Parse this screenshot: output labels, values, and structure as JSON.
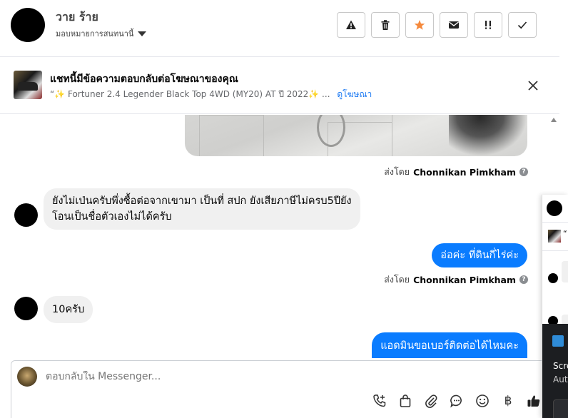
{
  "header": {
    "contact_name": "วาย ร้าย",
    "assign_label": "มอบหมายการสนทนานี้",
    "actions": [
      {
        "name": "report-button",
        "icon": "warning-icon"
      },
      {
        "name": "delete-button",
        "icon": "trash-icon"
      },
      {
        "name": "star-button",
        "icon": "star-icon"
      },
      {
        "name": "mark-unread-button",
        "icon": "envelope-icon"
      },
      {
        "name": "follow-up-button",
        "icon": "follow-up-icon"
      },
      {
        "name": "done-button",
        "icon": "check-icon"
      }
    ],
    "accent_star": "#f5893c"
  },
  "ad": {
    "title": "แชทนี้มีข้อความตอบกลับต่อโฆษณาของคุณ",
    "subtitle": "“✨ Fortuner 2.4 Legender Black Top 4WD (MY20) AT ปี 2022✨ ...",
    "view_ad_link": "ดูโฆษณา"
  },
  "messages": {
    "sent_by_prefix": "ส่งโดย",
    "sender_name": "Chonnikan Pimkham",
    "help_glyph": "?",
    "in_1": "ยังไม่เป่นครับพึ่งซื้อต่อจากเขามา เป็นที่ สปก ยังเสียภาษีไม่ครบ5ปียัง",
    "in_1b": "โอนเป็นชื่อตัวเองไม่ได้ครับ",
    "out_1": "อ่อค่ะ ที่ดินกี่ไร่ค่ะ",
    "in_2": "10ครับ",
    "out_2": "แอดมินขอเบอร์ติดต่อได้ไหมคะ",
    "bubble_out_color": "#0a7cff"
  },
  "composer": {
    "placeholder": "ตอบกลับใน Messenger...",
    "tools": [
      "phone-plus-icon",
      "shopping-bag-icon",
      "paperclip-icon",
      "chat-bubble-icon",
      "smiley-icon",
      "baht-icon",
      "thumbs-up-icon"
    ],
    "baht_glyph": "฿"
  },
  "side_popup": {
    "quote_glyph": "“",
    "toast_line1": "Scre",
    "toast_line2": "Aut"
  }
}
